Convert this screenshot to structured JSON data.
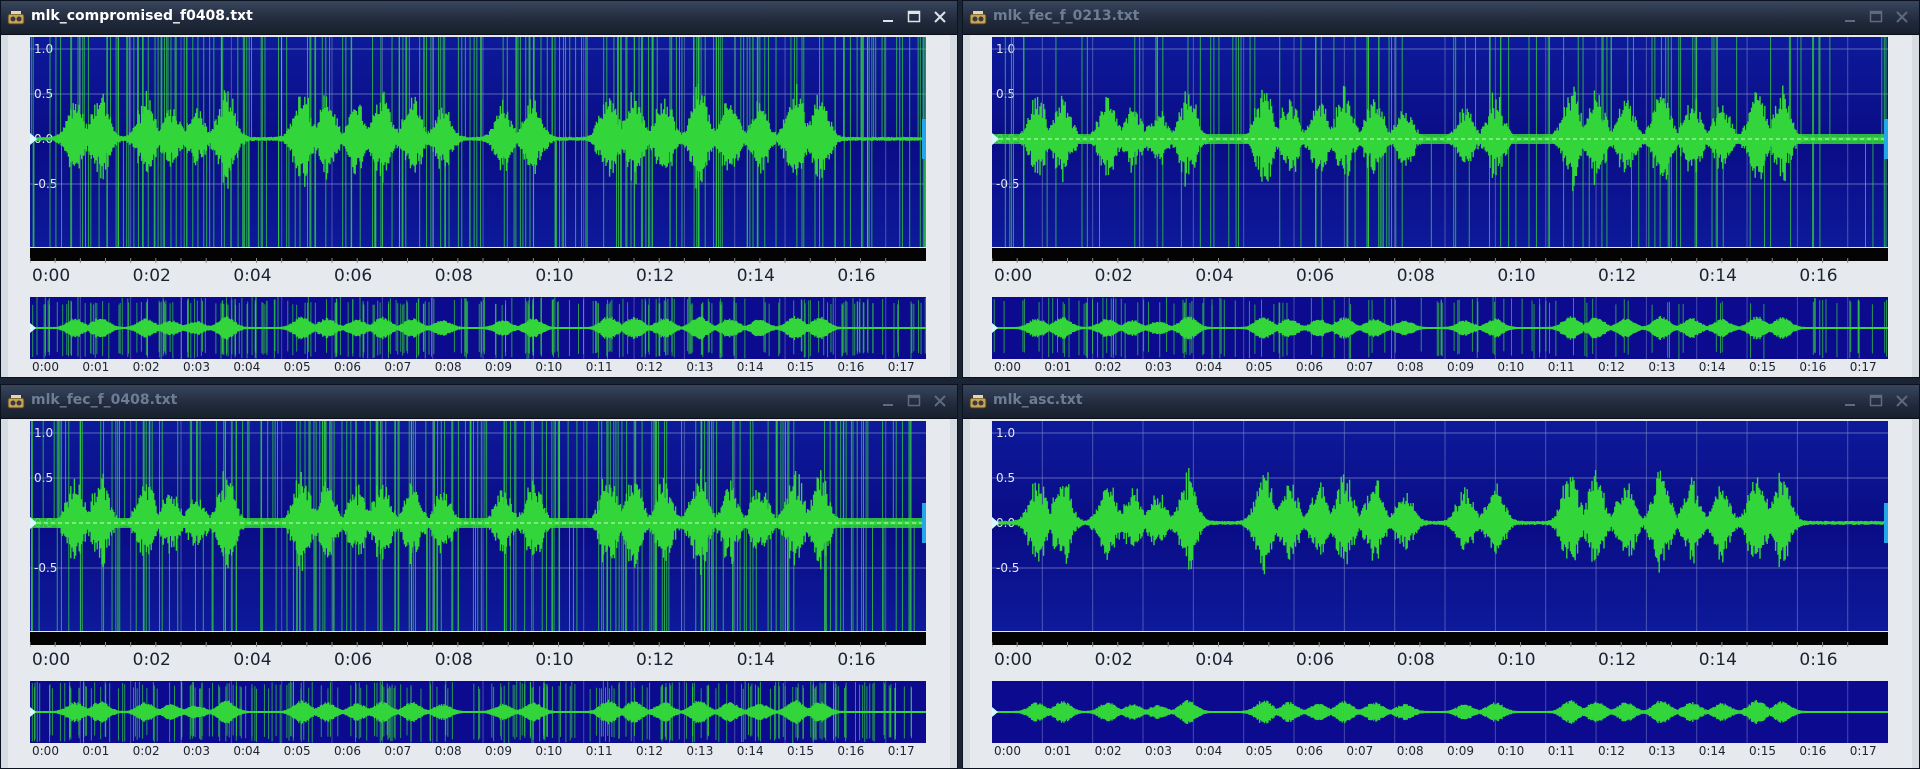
{
  "colors": {
    "plot_background": "#0c0a8f",
    "waveform": "#33d63a",
    "grid": "#8089c9",
    "title_active": "#ffffff",
    "title_inactive": "#6e7c95"
  },
  "y_axis_labels": [
    "1.0",
    "0.5",
    "0.0",
    "-0.5"
  ],
  "main_time_labels": [
    "0:00",
    "0:02",
    "0:04",
    "0:06",
    "0:08",
    "0:10",
    "0:12",
    "0:14",
    "0:16"
  ],
  "overview_time_labels": [
    "0:00",
    "0:01",
    "0:02",
    "0:03",
    "0:04",
    "0:05",
    "0:06",
    "0:07",
    "0:08",
    "0:09",
    "0:10",
    "0:11",
    "0:12",
    "0:13",
    "0:14",
    "0:15",
    "0:16",
    "0:17"
  ],
  "windows": [
    {
      "title": "mlk_compromised_f0408.txt",
      "active": true,
      "dropout_lines": "dense",
      "rail": false
    },
    {
      "title": "mlk_fec_f_0213.txt",
      "active": false,
      "dropout_lines": "medium",
      "rail": true
    },
    {
      "title": "mlk_fec_f_0408.txt",
      "active": false,
      "dropout_lines": "dense",
      "rail": true
    },
    {
      "title": "mlk_asc.txt",
      "active": false,
      "dropout_lines": "none",
      "rail": false
    }
  ],
  "icons": {
    "app": "audio-editor-app-icon",
    "minimize": "minimize-icon",
    "maximize": "maximize-icon",
    "close": "close-icon"
  }
}
